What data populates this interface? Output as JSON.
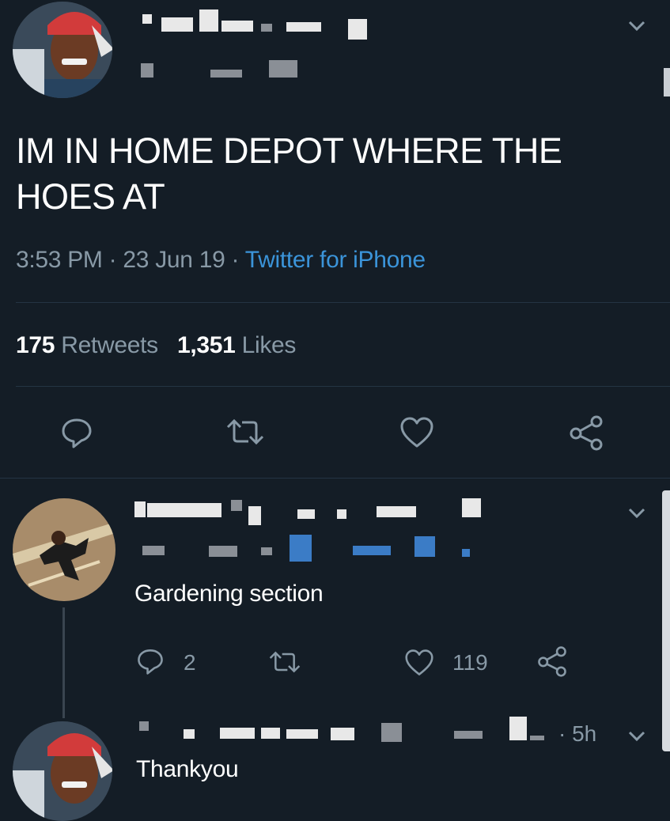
{
  "tweet": {
    "text": "IM IN HOME DEPOT WHERE THE HOES AT",
    "time": "3:53 PM",
    "date": "23 Jun 19",
    "source": "Twitter for iPhone",
    "retweets": "175",
    "retweets_label": "Retweets",
    "likes": "1,351",
    "likes_label": "Likes"
  },
  "icons": {
    "reply": "speech-bubble-icon",
    "retweet": "retweet-icon",
    "like": "heart-icon",
    "share": "share-icon",
    "more": "chevron-down-icon"
  },
  "replies": [
    {
      "text": "Gardening section",
      "reply_count": "2",
      "like_count": "119"
    },
    {
      "text": "Thankyou",
      "time": "5h"
    }
  ],
  "colors": {
    "background": "#141d26",
    "secondary_text": "#8899a6",
    "link": "#3b94d9"
  }
}
